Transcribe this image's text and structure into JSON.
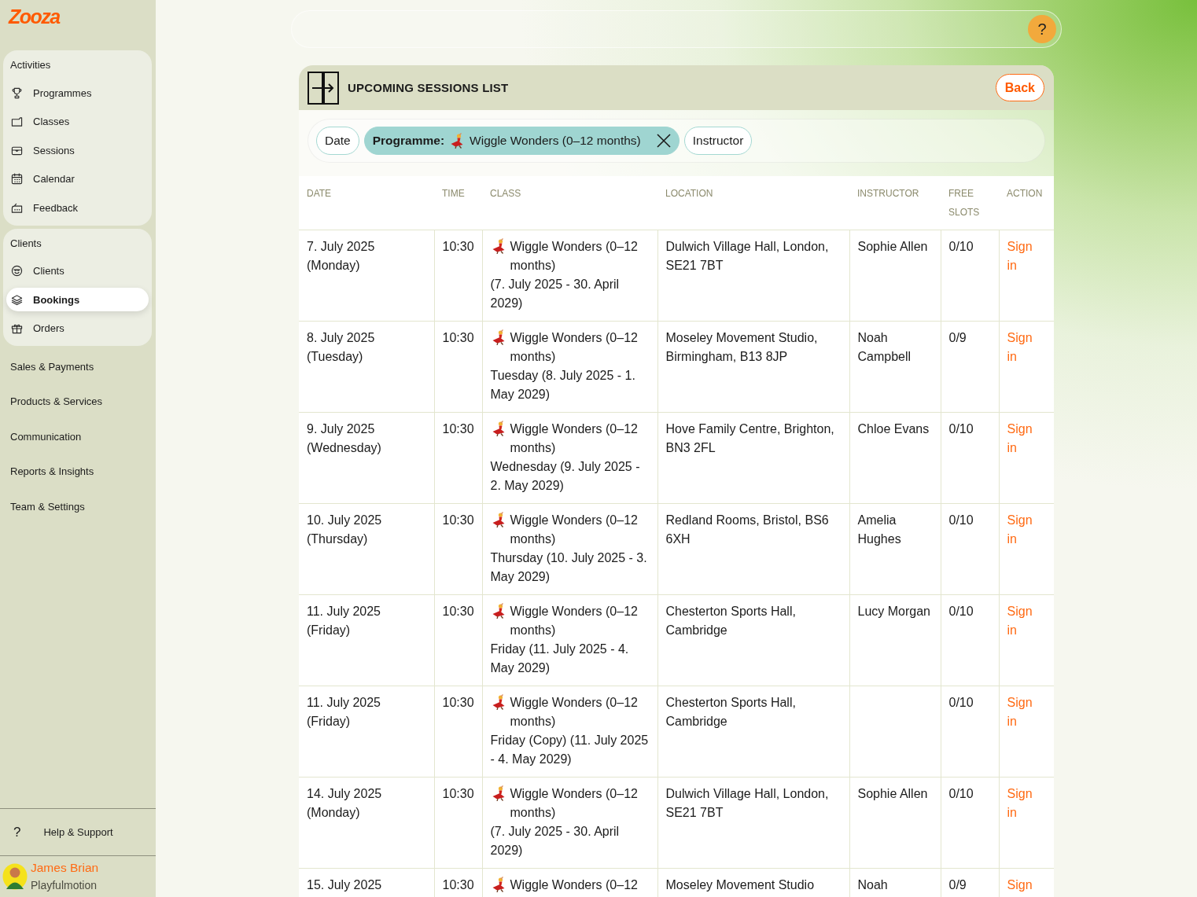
{
  "sidebar": {
    "logo": "Zooza",
    "sections": [
      {
        "label": "Activities",
        "expanded": true,
        "items": [
          {
            "label": "Programmes",
            "selected": false
          },
          {
            "label": "Classes",
            "selected": false
          },
          {
            "label": "Sessions",
            "selected": false
          },
          {
            "label": "Calendar",
            "selected": false
          },
          {
            "label": "Feedback",
            "selected": false
          }
        ]
      },
      {
        "label": "Clients",
        "expanded": true,
        "items": [
          {
            "label": "Clients",
            "selected": false
          },
          {
            "label": "Bookings",
            "selected": true
          },
          {
            "label": "Orders",
            "selected": false
          }
        ]
      },
      {
        "label": "Sales & Payments",
        "expanded": false
      },
      {
        "label": "Products & Services",
        "expanded": false
      },
      {
        "label": "Communication",
        "expanded": false
      },
      {
        "label": "Reports & Insights",
        "expanded": false
      },
      {
        "label": "Team & Settings",
        "expanded": false
      }
    ],
    "help": {
      "icon": "?",
      "label": "Help & Support"
    },
    "user": {
      "name": "James Brian",
      "organisation": "Playfulmotion"
    }
  },
  "top_bar": {
    "help_button": "?"
  },
  "panel": {
    "title": "UPCOMING SESSIONS LIST",
    "back_button": "Back",
    "filters": [
      {
        "label": "Date",
        "active": false
      },
      {
        "label": "Programme:",
        "value": "Wiggle Wonders (0–12 months)",
        "active": true
      },
      {
        "label": "Instructor",
        "active": false
      }
    ],
    "table": {
      "columns": [
        "DATE",
        "TIME",
        "CLASS",
        "LOCATION",
        "INSTRUCTOR",
        "FREE SLOTS",
        "ACTION"
      ],
      "rows": [
        {
          "date": "7. July 2025",
          "day": "(Monday)",
          "time": "10:30",
          "class": "Wiggle Wonders (0–12 months)",
          "schedule": "(7. July 2025 - 30. April 2029)",
          "location": "Dulwich Village Hall, London, SE21 7BT",
          "instructor": "Sophie Allen",
          "free_slots": "0/10",
          "action": "Sign in"
        },
        {
          "date": "8. July 2025",
          "day": "(Tuesday)",
          "time": "10:30",
          "class": "Wiggle Wonders (0–12 months)",
          "schedule": "Tuesday (8. July 2025 - 1. May 2029)",
          "location": "Moseley Movement Studio, Birmingham, B13 8JP",
          "instructor": "Noah Campbell",
          "free_slots": "0/9",
          "action": "Sign in"
        },
        {
          "date": "9. July 2025",
          "day": "(Wednesday)",
          "time": "10:30",
          "class": "Wiggle Wonders (0–12 months)",
          "schedule": "Wednesday (9. July 2025 - 2. May 2029)",
          "location": "Hove Family Centre, Brighton, BN3 2FL",
          "instructor": "Chloe Evans",
          "free_slots": "0/10",
          "action": "Sign in"
        },
        {
          "date": "10. July 2025",
          "day": "(Thursday)",
          "time": "10:30",
          "class": "Wiggle Wonders (0–12 months)",
          "schedule": "Thursday (10. July 2025 - 3. May 2029)",
          "location": "Redland Rooms, Bristol, BS6 6XH",
          "instructor": "Amelia Hughes",
          "free_slots": "0/10",
          "action": "Sign in"
        },
        {
          "date": "11. July 2025",
          "day": "(Friday)",
          "time": "10:30",
          "class": "Wiggle Wonders (0–12 months)",
          "schedule": "Friday (11. July 2025 - 4. May 2029)",
          "location": "Chesterton Sports Hall, Cambridge",
          "instructor": "Lucy Morgan",
          "free_slots": "0/10",
          "action": "Sign in"
        },
        {
          "date": "11. July 2025",
          "day": "(Friday)",
          "time": "10:30",
          "class": "Wiggle Wonders (0–12 months)",
          "schedule": "Friday (Copy) (11. July 2025 - 4. May 2029)",
          "location": "Chesterton Sports Hall, Cambridge",
          "free_slots": "0/10",
          "action": "Sign in"
        },
        {
          "date": "14. July 2025",
          "day": "(Monday)",
          "time": "10:30",
          "class": "Wiggle Wonders (0–12 months)",
          "schedule": "(7. July 2025 - 30. April 2029)",
          "location": "Dulwich Village Hall, London, SE21 7BT",
          "instructor": "Sophie Allen",
          "free_slots": "0/10",
          "action": "Sign in"
        },
        {
          "date": "15. July 2025",
          "time": "10:30",
          "class": "Wiggle Wonders (0–12",
          "location": "Moseley Movement Studio",
          "instructor": "Noah",
          "free_slots": "0/9",
          "action": "Sign"
        }
      ]
    }
  }
}
